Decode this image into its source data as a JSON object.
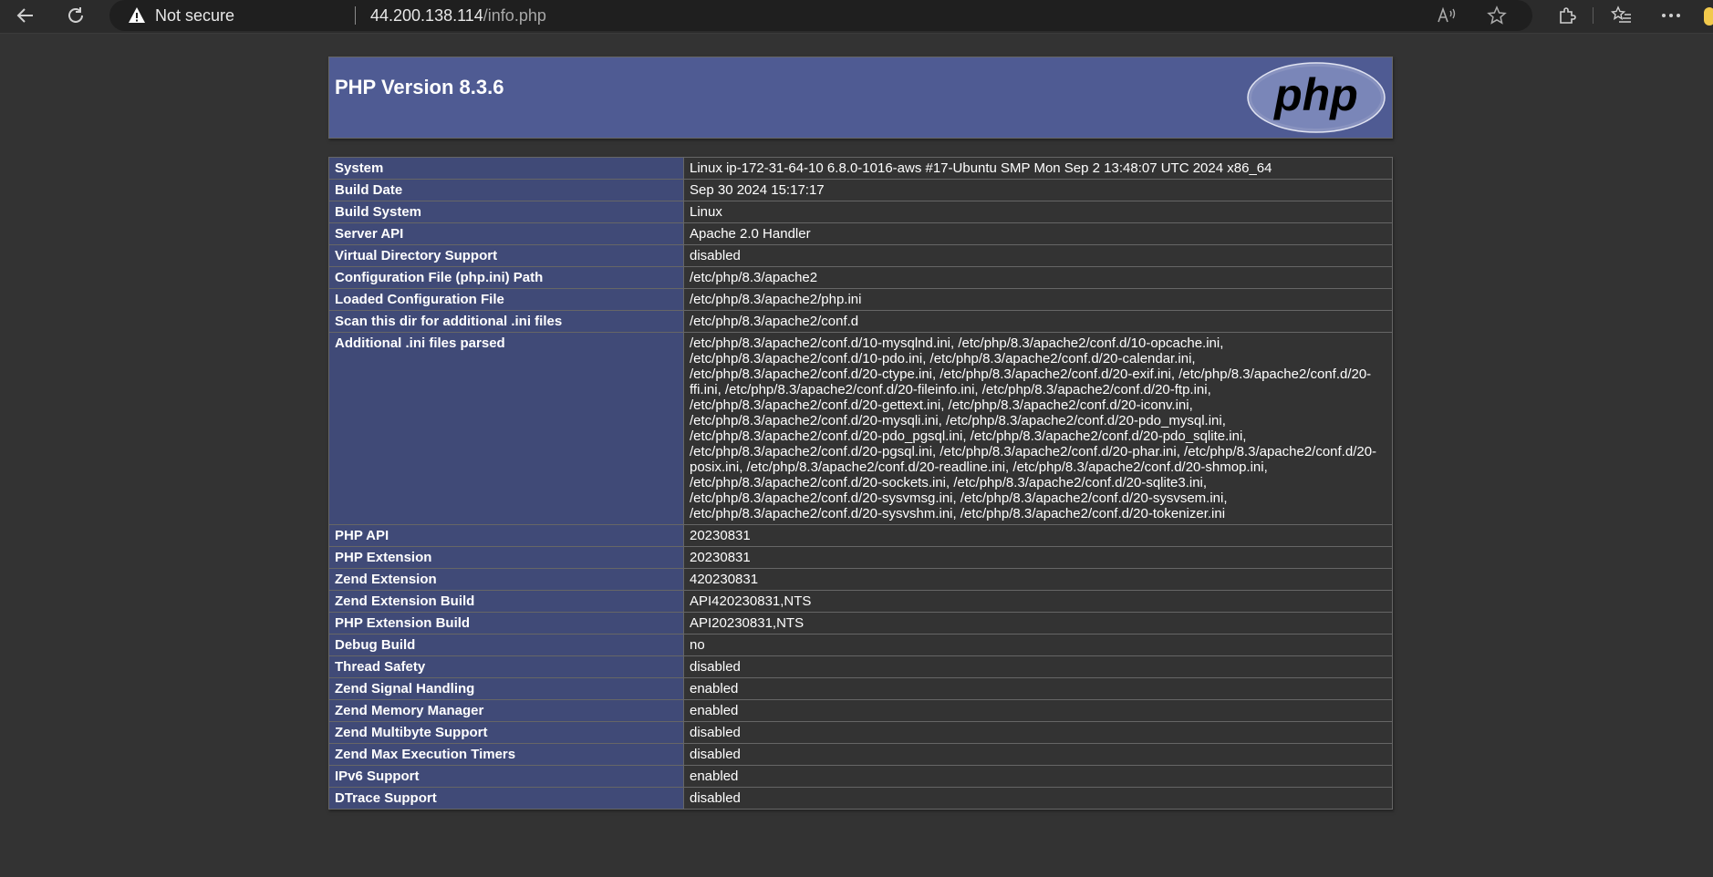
{
  "browser": {
    "security_label": "Not secure",
    "url_host": "44.200.138.114",
    "url_path": "/info.php"
  },
  "page": {
    "title": "PHP Version 8.3.6",
    "logo_text": "php"
  },
  "rows": [
    {
      "label": "System",
      "value": "Linux ip-172-31-64-10 6.8.0-1016-aws #17-Ubuntu SMP Mon Sep 2 13:48:07 UTC 2024 x86_64"
    },
    {
      "label": "Build Date",
      "value": "Sep 30 2024 15:17:17"
    },
    {
      "label": "Build System",
      "value": "Linux"
    },
    {
      "label": "Server API",
      "value": "Apache 2.0 Handler"
    },
    {
      "label": "Virtual Directory Support",
      "value": "disabled"
    },
    {
      "label": "Configuration File (php.ini) Path",
      "value": "/etc/php/8.3/apache2"
    },
    {
      "label": "Loaded Configuration File",
      "value": "/etc/php/8.3/apache2/php.ini"
    },
    {
      "label": "Scan this dir for additional .ini files",
      "value": "/etc/php/8.3/apache2/conf.d"
    },
    {
      "label": "Additional .ini files parsed",
      "value": "/etc/php/8.3/apache2/conf.d/10-mysqlnd.ini, /etc/php/8.3/apache2/conf.d/10-opcache.ini, /etc/php/8.3/apache2/conf.d/10-pdo.ini, /etc/php/8.3/apache2/conf.d/20-calendar.ini, /etc/php/8.3/apache2/conf.d/20-ctype.ini, /etc/php/8.3/apache2/conf.d/20-exif.ini, /etc/php/8.3/apache2/conf.d/20-ffi.ini, /etc/php/8.3/apache2/conf.d/20-fileinfo.ini, /etc/php/8.3/apache2/conf.d/20-ftp.ini, /etc/php/8.3/apache2/conf.d/20-gettext.ini, /etc/php/8.3/apache2/conf.d/20-iconv.ini, /etc/php/8.3/apache2/conf.d/20-mysqli.ini, /etc/php/8.3/apache2/conf.d/20-pdo_mysql.ini, /etc/php/8.3/apache2/conf.d/20-pdo_pgsql.ini, /etc/php/8.3/apache2/conf.d/20-pdo_sqlite.ini, /etc/php/8.3/apache2/conf.d/20-pgsql.ini, /etc/php/8.3/apache2/conf.d/20-phar.ini, /etc/php/8.3/apache2/conf.d/20-posix.ini, /etc/php/8.3/apache2/conf.d/20-readline.ini, /etc/php/8.3/apache2/conf.d/20-shmop.ini, /etc/php/8.3/apache2/conf.d/20-sockets.ini, /etc/php/8.3/apache2/conf.d/20-sqlite3.ini, /etc/php/8.3/apache2/conf.d/20-sysvmsg.ini, /etc/php/8.3/apache2/conf.d/20-sysvsem.ini, /etc/php/8.3/apache2/conf.d/20-sysvshm.ini, /etc/php/8.3/apache2/conf.d/20-tokenizer.ini"
    },
    {
      "label": "PHP API",
      "value": "20230831"
    },
    {
      "label": "PHP Extension",
      "value": "20230831"
    },
    {
      "label": "Zend Extension",
      "value": "420230831"
    },
    {
      "label": "Zend Extension Build",
      "value": "API420230831,NTS"
    },
    {
      "label": "PHP Extension Build",
      "value": "API20230831,NTS"
    },
    {
      "label": "Debug Build",
      "value": "no"
    },
    {
      "label": "Thread Safety",
      "value": "disabled"
    },
    {
      "label": "Zend Signal Handling",
      "value": "enabled"
    },
    {
      "label": "Zend Memory Manager",
      "value": "enabled"
    },
    {
      "label": "Zend Multibyte Support",
      "value": "disabled"
    },
    {
      "label": "Zend Max Execution Timers",
      "value": "disabled"
    },
    {
      "label": "IPv6 Support",
      "value": "enabled"
    },
    {
      "label": "DTrace Support",
      "value": "disabled"
    }
  ],
  "colors": {
    "page_bg": "#333333",
    "header_bg": "#4f5b93",
    "label_cell_bg": "#404a77",
    "border": "#666666"
  }
}
